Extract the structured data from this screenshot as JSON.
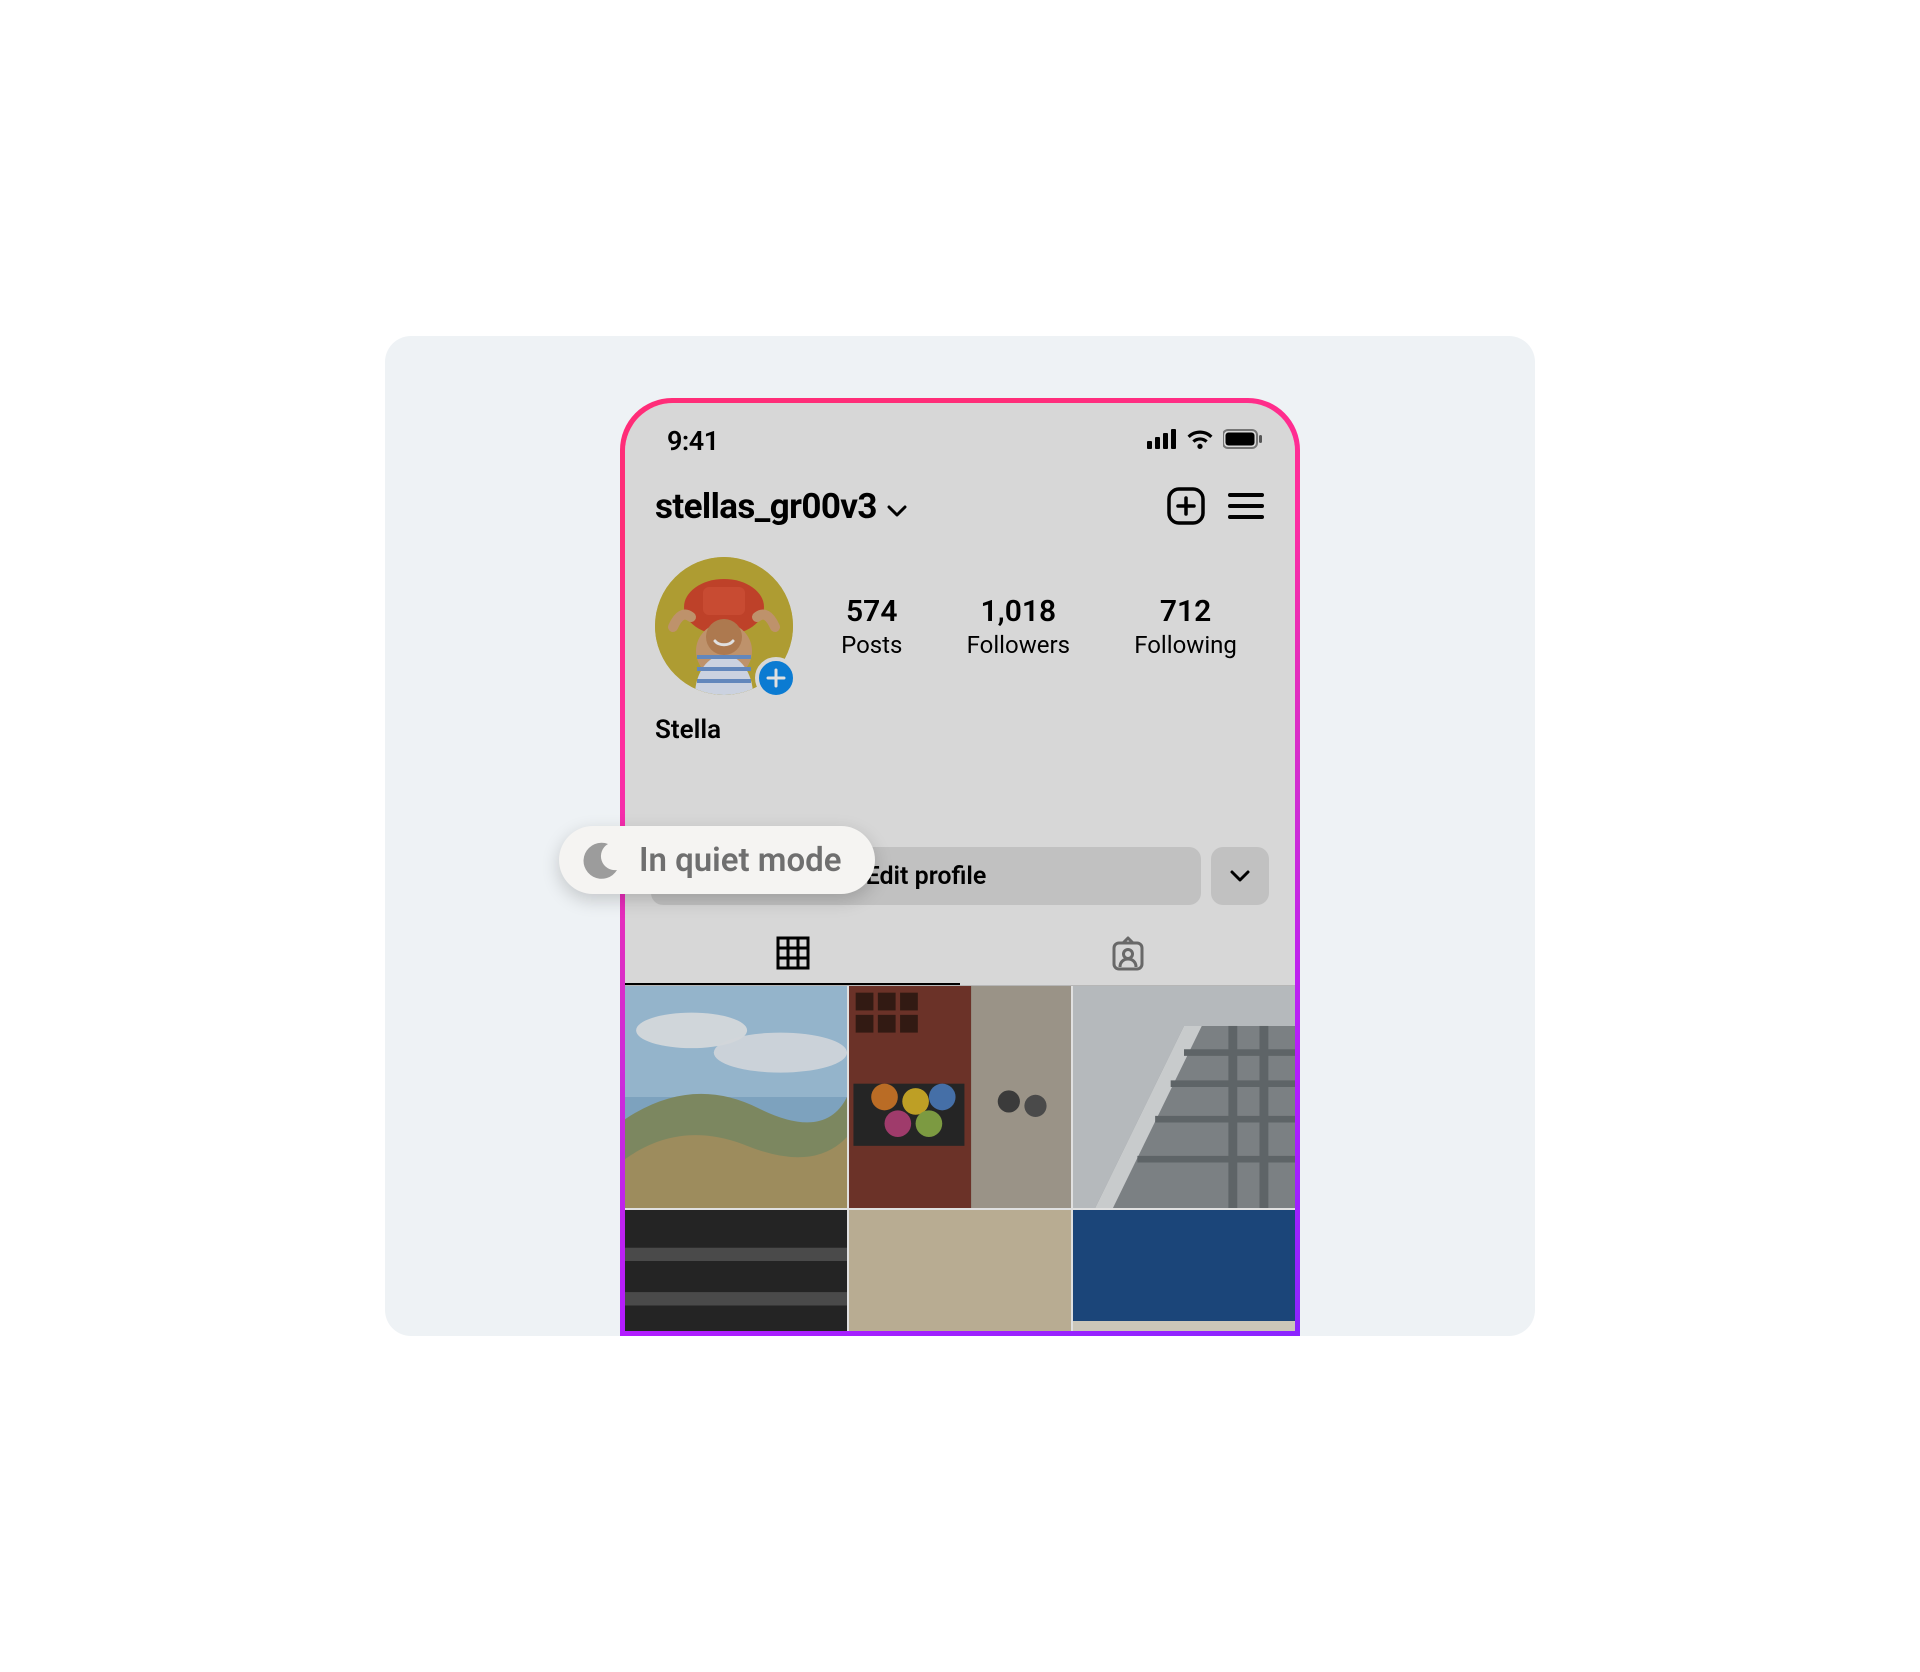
{
  "status": {
    "time": "9:41"
  },
  "header": {
    "username": "stellas_gr00v3"
  },
  "profile": {
    "display_name": "Stella",
    "stats": {
      "posts": {
        "count": "574",
        "label": "Posts"
      },
      "followers": {
        "count": "1,018",
        "label": "Followers"
      },
      "following": {
        "count": "712",
        "label": "Following"
      }
    }
  },
  "quiet_mode": {
    "label": "In quiet mode"
  },
  "actions": {
    "edit_label": "Edit profile"
  }
}
